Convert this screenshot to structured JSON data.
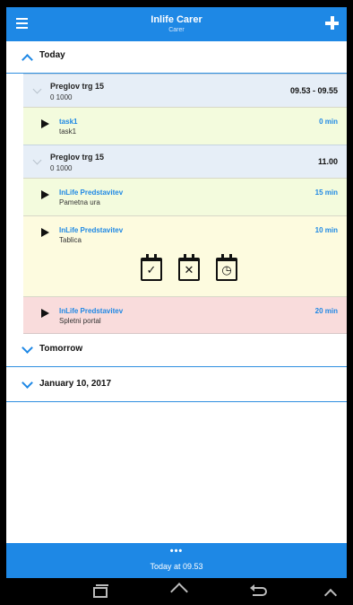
{
  "header": {
    "title": "Inlife Carer",
    "subtitle": "Carer",
    "menu_icon": "menu-icon",
    "add_icon": "plus-icon"
  },
  "sections": [
    {
      "label": "Today",
      "expanded": true
    },
    {
      "label": "Tomorrow",
      "expanded": false
    },
    {
      "label": "January 10, 2017",
      "expanded": false
    }
  ],
  "groups": [
    {
      "title": "Preglov trg 15",
      "subtitle": "0 1000",
      "time": "09.53 - 09.55"
    },
    {
      "title": "Preglov trg 15",
      "subtitle": "0 1000",
      "time": "11.00"
    }
  ],
  "tasks": [
    {
      "title": "task1",
      "subtitle": "task1",
      "duration": "0 min",
      "status_color": "#f3fbdd"
    },
    {
      "title": "InLife Predstavitev",
      "subtitle": "Pametna ura",
      "duration": "15 min",
      "status_color": "#f3fbdd"
    },
    {
      "title": "InLife Predstavitev",
      "subtitle": "Tablica",
      "duration": "10 min",
      "status_color": "#fdfbdf"
    },
    {
      "title": "InLife Predstavitev",
      "subtitle": "Spletni portal",
      "duration": "20 min",
      "status_color": "#f9dcdc"
    }
  ],
  "task_actions": [
    {
      "icon": "calendar-check-icon",
      "glyph": "✓"
    },
    {
      "icon": "calendar-cancel-icon",
      "glyph": "✕"
    },
    {
      "icon": "calendar-clock-icon",
      "glyph": "◷"
    }
  ],
  "footer": {
    "dots": "•••",
    "text": "Today at 09.53"
  },
  "colors": {
    "accent": "#1e88e5",
    "group_bg": "#e6eef7"
  }
}
